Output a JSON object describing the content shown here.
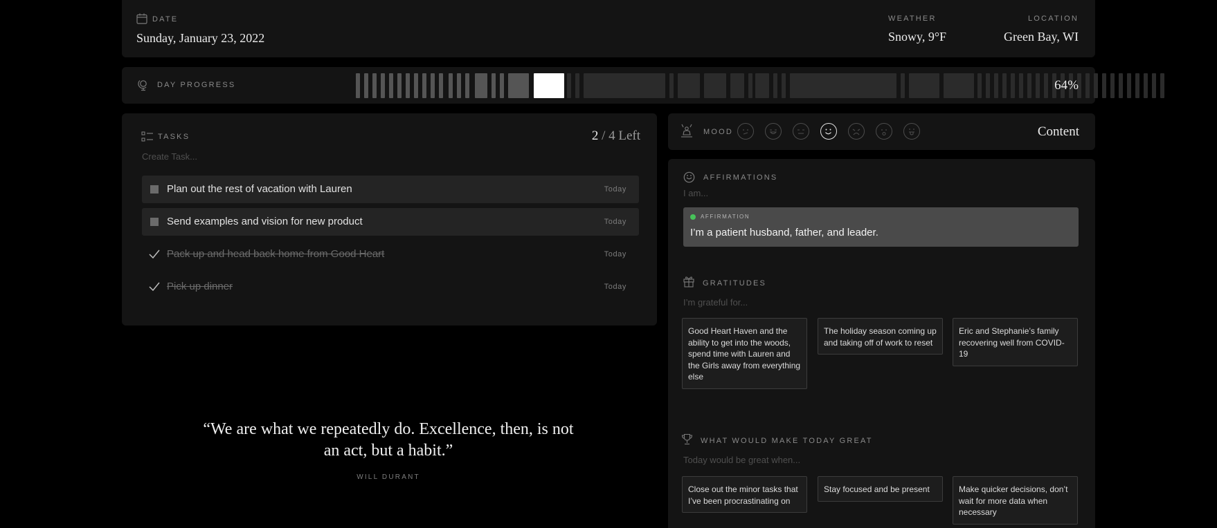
{
  "header": {
    "date_label": "Date",
    "date_value": "Sunday, January 23, 2022",
    "weather_label": "Weather",
    "weather_value": "Snowy, 9°F",
    "location_label": "Location",
    "location_value": "Green Bay, WI"
  },
  "progress": {
    "label": "Day Progress",
    "percent_text": "64%",
    "fraction": 0.64
  },
  "tasks": {
    "label": "Tasks",
    "count_done": "2",
    "count_rest": " / 4 Left",
    "create_placeholder": "Create Task...",
    "items": [
      {
        "text": "Plan out the rest of vacation with Lauren",
        "due": "Today",
        "done": false
      },
      {
        "text": "Send examples and vision for new product",
        "due": "Today",
        "done": false
      },
      {
        "text": "Pack up and head back home from Good Heart",
        "due": "Today",
        "done": true
      },
      {
        "text": "Pick up dinner",
        "due": "Today",
        "done": true
      }
    ]
  },
  "quote": {
    "text": "“We are what we repeatedly do. Excellence, then, is not an act, but a habit.”",
    "author": "Will Durant"
  },
  "mood": {
    "label": "Mood",
    "value": "Content",
    "selected_index": 3,
    "faces": [
      "sad-face-icon",
      "laughing-face-icon",
      "neutral-face-icon",
      "smiling-face-icon",
      "frowning-face-icon",
      "surprised-face-icon",
      "tongue-face-icon"
    ]
  },
  "affirmations": {
    "label": "Affirmations",
    "placeholder": "I am...",
    "card_caption": "Affirmation",
    "card_text": "I’m a patient husband, father, and leader."
  },
  "gratitudes": {
    "label": "Gratitudes",
    "placeholder": "I’m grateful for...",
    "items": [
      "Good Heart Haven and the ability to get into the woods, spend time with Lauren and the Girls away from everything else",
      "The holiday season coming up and taking off of work to reset",
      "Eric and Stephanie’s family recovering well from COVID-19"
    ]
  },
  "great": {
    "label": "What would make today great",
    "placeholder": "Today would be great when...",
    "items": [
      "Close out the minor tasks that I’ve been procrastinating on",
      "Stay focused and be present",
      "Make quicker decisions, don’t wait for more data when necessary"
    ]
  }
}
